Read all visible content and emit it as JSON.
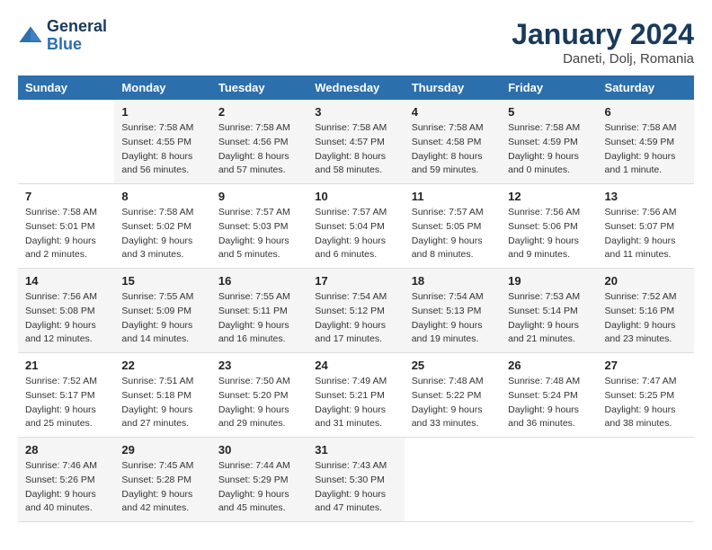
{
  "header": {
    "logo_line1": "General",
    "logo_line2": "Blue",
    "month": "January 2024",
    "location": "Daneti, Dolj, Romania"
  },
  "weekdays": [
    "Sunday",
    "Monday",
    "Tuesday",
    "Wednesday",
    "Thursday",
    "Friday",
    "Saturday"
  ],
  "weeks": [
    [
      {
        "day": "",
        "info": ""
      },
      {
        "day": "1",
        "info": "Sunrise: 7:58 AM\nSunset: 4:55 PM\nDaylight: 8 hours\nand 56 minutes."
      },
      {
        "day": "2",
        "info": "Sunrise: 7:58 AM\nSunset: 4:56 PM\nDaylight: 8 hours\nand 57 minutes."
      },
      {
        "day": "3",
        "info": "Sunrise: 7:58 AM\nSunset: 4:57 PM\nDaylight: 8 hours\nand 58 minutes."
      },
      {
        "day": "4",
        "info": "Sunrise: 7:58 AM\nSunset: 4:58 PM\nDaylight: 8 hours\nand 59 minutes."
      },
      {
        "day": "5",
        "info": "Sunrise: 7:58 AM\nSunset: 4:59 PM\nDaylight: 9 hours\nand 0 minutes."
      },
      {
        "day": "6",
        "info": "Sunrise: 7:58 AM\nSunset: 4:59 PM\nDaylight: 9 hours\nand 1 minute."
      }
    ],
    [
      {
        "day": "7",
        "info": "Sunrise: 7:58 AM\nSunset: 5:01 PM\nDaylight: 9 hours\nand 2 minutes."
      },
      {
        "day": "8",
        "info": "Sunrise: 7:58 AM\nSunset: 5:02 PM\nDaylight: 9 hours\nand 3 minutes."
      },
      {
        "day": "9",
        "info": "Sunrise: 7:57 AM\nSunset: 5:03 PM\nDaylight: 9 hours\nand 5 minutes."
      },
      {
        "day": "10",
        "info": "Sunrise: 7:57 AM\nSunset: 5:04 PM\nDaylight: 9 hours\nand 6 minutes."
      },
      {
        "day": "11",
        "info": "Sunrise: 7:57 AM\nSunset: 5:05 PM\nDaylight: 9 hours\nand 8 minutes."
      },
      {
        "day": "12",
        "info": "Sunrise: 7:56 AM\nSunset: 5:06 PM\nDaylight: 9 hours\nand 9 minutes."
      },
      {
        "day": "13",
        "info": "Sunrise: 7:56 AM\nSunset: 5:07 PM\nDaylight: 9 hours\nand 11 minutes."
      }
    ],
    [
      {
        "day": "14",
        "info": "Sunrise: 7:56 AM\nSunset: 5:08 PM\nDaylight: 9 hours\nand 12 minutes."
      },
      {
        "day": "15",
        "info": "Sunrise: 7:55 AM\nSunset: 5:09 PM\nDaylight: 9 hours\nand 14 minutes."
      },
      {
        "day": "16",
        "info": "Sunrise: 7:55 AM\nSunset: 5:11 PM\nDaylight: 9 hours\nand 16 minutes."
      },
      {
        "day": "17",
        "info": "Sunrise: 7:54 AM\nSunset: 5:12 PM\nDaylight: 9 hours\nand 17 minutes."
      },
      {
        "day": "18",
        "info": "Sunrise: 7:54 AM\nSunset: 5:13 PM\nDaylight: 9 hours\nand 19 minutes."
      },
      {
        "day": "19",
        "info": "Sunrise: 7:53 AM\nSunset: 5:14 PM\nDaylight: 9 hours\nand 21 minutes."
      },
      {
        "day": "20",
        "info": "Sunrise: 7:52 AM\nSunset: 5:16 PM\nDaylight: 9 hours\nand 23 minutes."
      }
    ],
    [
      {
        "day": "21",
        "info": "Sunrise: 7:52 AM\nSunset: 5:17 PM\nDaylight: 9 hours\nand 25 minutes."
      },
      {
        "day": "22",
        "info": "Sunrise: 7:51 AM\nSunset: 5:18 PM\nDaylight: 9 hours\nand 27 minutes."
      },
      {
        "day": "23",
        "info": "Sunrise: 7:50 AM\nSunset: 5:20 PM\nDaylight: 9 hours\nand 29 minutes."
      },
      {
        "day": "24",
        "info": "Sunrise: 7:49 AM\nSunset: 5:21 PM\nDaylight: 9 hours\nand 31 minutes."
      },
      {
        "day": "25",
        "info": "Sunrise: 7:48 AM\nSunset: 5:22 PM\nDaylight: 9 hours\nand 33 minutes."
      },
      {
        "day": "26",
        "info": "Sunrise: 7:48 AM\nSunset: 5:24 PM\nDaylight: 9 hours\nand 36 minutes."
      },
      {
        "day": "27",
        "info": "Sunrise: 7:47 AM\nSunset: 5:25 PM\nDaylight: 9 hours\nand 38 minutes."
      }
    ],
    [
      {
        "day": "28",
        "info": "Sunrise: 7:46 AM\nSunset: 5:26 PM\nDaylight: 9 hours\nand 40 minutes."
      },
      {
        "day": "29",
        "info": "Sunrise: 7:45 AM\nSunset: 5:28 PM\nDaylight: 9 hours\nand 42 minutes."
      },
      {
        "day": "30",
        "info": "Sunrise: 7:44 AM\nSunset: 5:29 PM\nDaylight: 9 hours\nand 45 minutes."
      },
      {
        "day": "31",
        "info": "Sunrise: 7:43 AM\nSunset: 5:30 PM\nDaylight: 9 hours\nand 47 minutes."
      },
      {
        "day": "",
        "info": ""
      },
      {
        "day": "",
        "info": ""
      },
      {
        "day": "",
        "info": ""
      }
    ]
  ]
}
